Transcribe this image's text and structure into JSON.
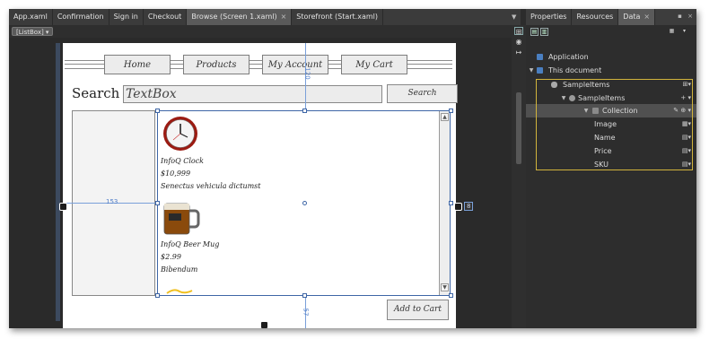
{
  "editor": {
    "document_tabs": [
      {
        "label": "App.xaml",
        "active": false
      },
      {
        "label": "Confirmation",
        "active": false
      },
      {
        "label": "Sign in",
        "active": false
      },
      {
        "label": "Checkout",
        "active": false
      },
      {
        "label": "Browse (Screen 1.xaml)",
        "active": true,
        "close": "×"
      },
      {
        "label": "Storefront (Start.xaml)",
        "active": false
      }
    ],
    "tabs_dropdown_glyph": "▼",
    "breadcrumb": "[ListBox] ▾"
  },
  "mockup": {
    "nav": [
      "Home",
      "Products",
      "My Account",
      "My Cart"
    ],
    "search_label": "Search",
    "search_textbox": "TextBox",
    "search_button": "Search",
    "products": [
      {
        "image": "clock-image",
        "name": "InfoQ Clock",
        "price": "$10,999",
        "description": "Senectus vehicula dictumst"
      },
      {
        "image": "beer-mug-image",
        "name": "InfoQ Beer Mug",
        "price": "$2.99",
        "description": "Bibendum"
      }
    ],
    "add_to_cart": "Add to Cart"
  },
  "adorners": {
    "left_margin": "153",
    "top_margin": "120",
    "bottom_margin": "57",
    "right_margin": "8"
  },
  "panel": {
    "tabs": [
      {
        "label": "Properties",
        "active": false
      },
      {
        "label": "Resources",
        "active": false
      },
      {
        "label": "Data",
        "active": true,
        "close": "×"
      }
    ],
    "pin_glyph": "▪",
    "close_glyph": "×",
    "tree": [
      {
        "label": "Application",
        "level": 0,
        "icon_color": "#4a7fc1",
        "arrow": ""
      },
      {
        "label": "This document",
        "level": 0,
        "icon_color": "#4a7fc1",
        "arrow": "▼"
      },
      {
        "label": "SampleItems",
        "level": 1,
        "icon_color": "#aaaaaa",
        "arrow": "",
        "action": "⊞▾"
      },
      {
        "label": "SampleItems",
        "level": 2,
        "icon_color": "#9a9a9a",
        "arrow": "▼",
        "action": "+ ▾"
      },
      {
        "label": "Collection",
        "level": 3,
        "icon_color": "#8a8a8a",
        "arrow": "▼",
        "action": "✎ ⊕ ▾",
        "selected": true
      },
      {
        "label": "Image",
        "level": 4,
        "action": "▦▾"
      },
      {
        "label": "Name",
        "level": 4,
        "action": "▤▾"
      },
      {
        "label": "Price",
        "level": 4,
        "action": "▤▾"
      },
      {
        "label": "SKU",
        "level": 4,
        "action": "▤▾"
      }
    ]
  },
  "colors": {
    "accent_blue": "#3e66a6",
    "highlight_gold": "#d2b43c",
    "panel_bg": "#2d2d2d"
  }
}
